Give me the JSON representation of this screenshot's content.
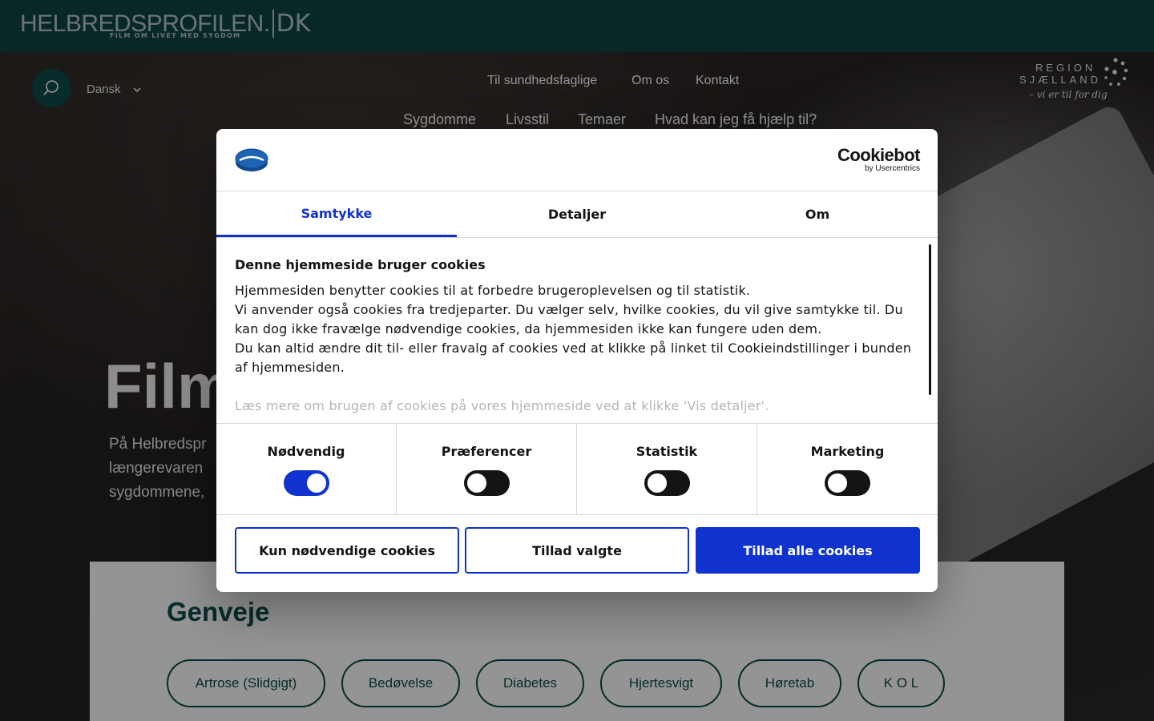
{
  "header": {
    "logo_text": "HELBREDSPROFILEN.",
    "logo_suffix": "DK",
    "logo_tagline": "FILM OM LIVET MED SYGDOM"
  },
  "nav": {
    "language": "Dansk",
    "top_links": [
      "Til sundhedsfaglige",
      "Om os",
      "Kontakt"
    ],
    "main_links": [
      "Sygdomme",
      "Livsstil",
      "Temaer",
      "Hvad kan jeg få hjælp til?"
    ]
  },
  "region_logo": {
    "line1": "REGION",
    "line2": "SJÆLLAND",
    "line3": "– vi er til for dig"
  },
  "hero": {
    "title": "Film",
    "text_lines": [
      "På Helbredspr",
      "længerevaren",
      "sygdommene,"
    ]
  },
  "shortcuts": {
    "heading": "Genveje",
    "items": [
      "Artrose (Slidgigt)",
      "Bedøvelse",
      "Diabetes",
      "Hjertesvigt",
      "Høretab",
      "K O L"
    ]
  },
  "cookie_dialog": {
    "brand": "Cookiebot",
    "brand_sub": "by Usercentrics",
    "tabs": [
      "Samtykke",
      "Detaljer",
      "Om"
    ],
    "active_tab": "Samtykke",
    "heading": "Denne hjemmeside bruger cookies",
    "paragraphs": [
      "Hjemmesiden benytter cookies til at forbedre brugeroplevelsen og til statistik.",
      "Vi anvender også cookies fra tredjeparter. Du vælger selv, hvilke cookies, du vil give samtykke til. Du kan dog ikke fravælge nødvendige cookies, da hjemmesiden ikke kan fungere uden dem.",
      "Du kan altid ændre dit til- eller fravalg af cookies ved at klikke på linket til Cookieindstillinger i bunden af hjemmesiden."
    ],
    "faded_paragraph": "Læs mere om brugen af cookies på vores hjemmeside ved at klikke 'Vis detaljer'.",
    "toggles": [
      {
        "label": "Nødvendig",
        "on": true
      },
      {
        "label": "Præferencer",
        "on": false
      },
      {
        "label": "Statistik",
        "on": false
      },
      {
        "label": "Marketing",
        "on": false
      }
    ],
    "buttons": {
      "necessary_only": "Kun nødvendige cookies",
      "allow_selected": "Tillad valgte",
      "allow_all": "Tillad alle cookies"
    }
  },
  "colors": {
    "header_bg": "#0f4646",
    "accent_teal": "#0e4a4a",
    "cookie_blue": "#1032cf"
  }
}
